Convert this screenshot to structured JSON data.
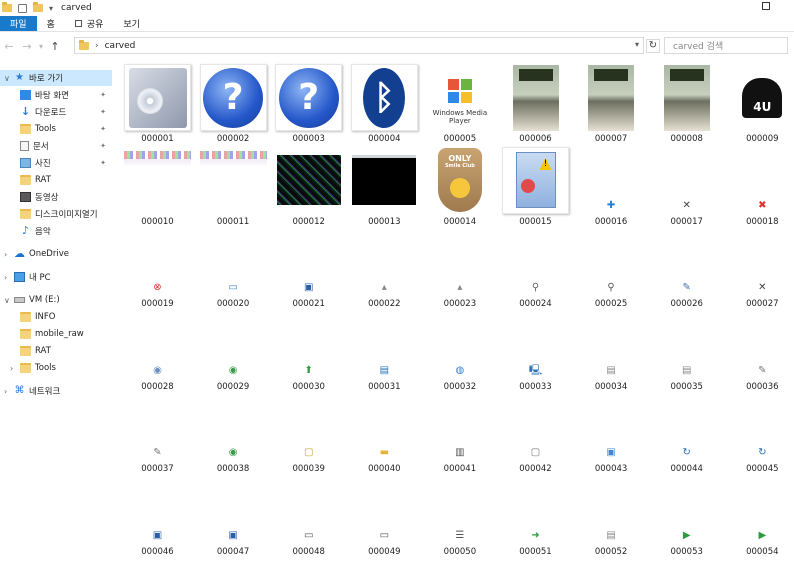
{
  "window": {
    "title": "carved"
  },
  "ribbon": {
    "tabs": [
      "파일",
      "홈",
      "공유",
      "보기"
    ]
  },
  "address": {
    "path": "carved",
    "search_placeholder": "carved 검색"
  },
  "sidebar": {
    "quick_access": "바로 가기",
    "quick_items": [
      {
        "label": "바탕 화면",
        "icon": "desktop-icon",
        "pinned": true
      },
      {
        "label": "다운로드",
        "icon": "download-icon",
        "pinned": true
      },
      {
        "label": "Tools",
        "icon": "folder-icon",
        "pinned": true
      },
      {
        "label": "문서",
        "icon": "documents-icon",
        "pinned": true
      },
      {
        "label": "사진",
        "icon": "pictures-icon",
        "pinned": true
      },
      {
        "label": "RAT",
        "icon": "folder-icon",
        "pinned": false
      },
      {
        "label": "동영상",
        "icon": "videos-icon",
        "pinned": false
      },
      {
        "label": "디스크이미지열기",
        "icon": "folder-icon",
        "pinned": false
      },
      {
        "label": "음악",
        "icon": "music-icon",
        "pinned": false
      }
    ],
    "onedrive": "OneDrive",
    "this_pc": "내 PC",
    "drive": "VM (E:)",
    "drive_items": [
      "INFO",
      "mobile_raw",
      "RAT",
      "Tools"
    ],
    "network": "네트워크"
  },
  "files": [
    {
      "name": "000001",
      "icon": "cd-box-icon"
    },
    {
      "name": "000002",
      "icon": "help-icon"
    },
    {
      "name": "000003",
      "icon": "help-icon"
    },
    {
      "name": "000004",
      "icon": "bluetooth-icon"
    },
    {
      "name": "000005",
      "icon": "windows-media-player-icon",
      "caption": "Windows Media Player"
    },
    {
      "name": "000006",
      "icon": "poster-thumbnail"
    },
    {
      "name": "000007",
      "icon": "poster-thumbnail"
    },
    {
      "name": "000008",
      "icon": "poster-thumbnail"
    },
    {
      "name": "000009",
      "icon": "helmet-logo-icon",
      "caption": "4U"
    },
    {
      "name": "000010",
      "icon": "glitch-thumbnail"
    },
    {
      "name": "000011",
      "icon": "glitch-thumbnail"
    },
    {
      "name": "000012",
      "icon": "noise-thumbnail"
    },
    {
      "name": "000013",
      "icon": "black-thumbnail"
    },
    {
      "name": "000014",
      "icon": "smile-club-icon",
      "caption": "ONLY Smile Club"
    },
    {
      "name": "000015",
      "icon": "document-warning-icon"
    },
    {
      "name": "000016",
      "icon": "plus-icon"
    },
    {
      "name": "000017",
      "icon": "close-icon"
    },
    {
      "name": "000018",
      "icon": "error-x-icon"
    },
    {
      "name": "000019",
      "icon": "error-circle-icon"
    },
    {
      "name": "000020",
      "icon": "monitor-icon"
    },
    {
      "name": "000021",
      "icon": "save-icon"
    },
    {
      "name": "000022",
      "icon": "small-mark-icon"
    },
    {
      "name": "000023",
      "icon": "small-mark-icon"
    },
    {
      "name": "000024",
      "icon": "key-icon"
    },
    {
      "name": "000025",
      "icon": "search-icon"
    },
    {
      "name": "000026",
      "icon": "tools-icon"
    },
    {
      "name": "000027",
      "icon": "close-icon"
    },
    {
      "name": "000028",
      "icon": "up-circle-icon"
    },
    {
      "name": "000029",
      "icon": "down-circle-icon"
    },
    {
      "name": "000030",
      "icon": "up-arrow-icon"
    },
    {
      "name": "000031",
      "icon": "network-pc-icon"
    },
    {
      "name": "000032",
      "icon": "globe-icon"
    },
    {
      "name": "000033",
      "icon": "computer-network-icon"
    },
    {
      "name": "000034",
      "icon": "document-icon"
    },
    {
      "name": "000035",
      "icon": "document-icon"
    },
    {
      "name": "000036",
      "icon": "edit-icon"
    },
    {
      "name": "000037",
      "icon": "edit-icon"
    },
    {
      "name": "000038",
      "icon": "down-circle-icon"
    },
    {
      "name": "000039",
      "icon": "new-document-icon"
    },
    {
      "name": "000040",
      "icon": "folder-open-icon"
    },
    {
      "name": "000041",
      "icon": "book-icon"
    },
    {
      "name": "000042",
      "icon": "box-icon"
    },
    {
      "name": "000043",
      "icon": "image-icon"
    },
    {
      "name": "000044",
      "icon": "rotate-icon"
    },
    {
      "name": "000045",
      "icon": "rotate-icon"
    },
    {
      "name": "000046",
      "icon": "save-icon"
    },
    {
      "name": "000047",
      "icon": "save-icon"
    },
    {
      "name": "000048",
      "icon": "window-icon"
    },
    {
      "name": "000049",
      "icon": "window-icon"
    },
    {
      "name": "000050",
      "icon": "list-icon"
    },
    {
      "name": "000051",
      "icon": "export-icon"
    },
    {
      "name": "000052",
      "icon": "document-icon"
    },
    {
      "name": "000053",
      "icon": "play-icon"
    },
    {
      "name": "000054",
      "icon": "play-icon"
    }
  ]
}
